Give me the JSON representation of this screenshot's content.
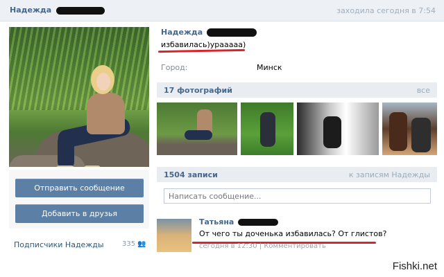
{
  "header": {
    "name": "Надежда",
    "last_seen": "заходила сегодня в 7:54"
  },
  "profile": {
    "name": "Надежда",
    "status": "избавилась)урааааа)",
    "city_label": "Город:",
    "city_value": "Минск"
  },
  "actions": {
    "send_message": "Отправить сообщение",
    "add_friend": "Добавить в друзья"
  },
  "subscribers": {
    "label": "Подписчики Надежды",
    "count": "335"
  },
  "photos": {
    "title": "17 фотографий",
    "all_link": "все"
  },
  "posts": {
    "title": "1504 записи",
    "to_posts_link": "к записям Надежды",
    "input_placeholder": "Написать сообщение..."
  },
  "comment": {
    "author": "Татьяна",
    "text": "От чего ты доченька избавилась? От глистов?",
    "time": "сегодня в 12:30",
    "reply": "Комментировать"
  },
  "watermark": "Fishki.net",
  "colors": {
    "link": "#45688e",
    "button": "#5c7fa6",
    "highlight_underline": "#d4262b",
    "section_bg": "#e9edf1"
  }
}
